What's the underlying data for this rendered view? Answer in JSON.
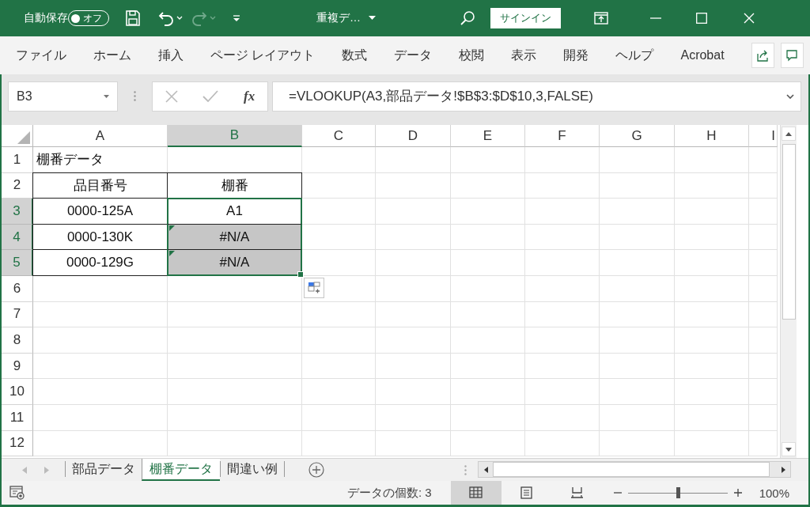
{
  "title_bar": {
    "autosave_label": "自動保存",
    "autosave": {
      "on": false,
      "label": "オフ"
    },
    "document_title": "重複デ…",
    "signin_button": "サインイン"
  },
  "ribbon_tabs": [
    {
      "label": "ファイル"
    },
    {
      "label": "ホーム"
    },
    {
      "label": "挿入"
    },
    {
      "label": "ページ レイアウト"
    },
    {
      "label": "数式"
    },
    {
      "label": "データ"
    },
    {
      "label": "校閲"
    },
    {
      "label": "表示"
    },
    {
      "label": "開発"
    },
    {
      "label": "ヘルプ"
    },
    {
      "label": "Acrobat"
    }
  ],
  "formula_bar": {
    "name_box": "B3",
    "fx_label": "fx",
    "formula": "=VLOOKUP(A3,部品データ!$B$3:$D$10,3,FALSE)"
  },
  "columns": [
    {
      "label": "A",
      "selected": false
    },
    {
      "label": "B",
      "selected": true
    },
    {
      "label": "C",
      "selected": false
    },
    {
      "label": "D",
      "selected": false
    },
    {
      "label": "E",
      "selected": false
    },
    {
      "label": "F",
      "selected": false
    },
    {
      "label": "G",
      "selected": false
    },
    {
      "label": "H",
      "selected": false
    },
    {
      "label": "I",
      "selected": false
    }
  ],
  "rows": [
    {
      "label": "1",
      "selected": false,
      "cells": [
        {
          "kind": "title",
          "text": "棚番データ",
          "bordered": false,
          "selected": false,
          "error_flag": false
        }
      ]
    },
    {
      "label": "2",
      "selected": false,
      "cells": [
        {
          "kind": "value",
          "text": "品目番号",
          "bordered": true,
          "selected": false,
          "error_flag": false
        },
        {
          "kind": "value",
          "text": "棚番",
          "bordered": true,
          "selected": false,
          "error_flag": false
        }
      ]
    },
    {
      "label": "3",
      "selected": true,
      "cells": [
        {
          "kind": "value",
          "text": "0000-125A",
          "bordered": true,
          "selected": false,
          "error_flag": false
        },
        {
          "kind": "value",
          "text": "A1",
          "bordered": true,
          "selected": true,
          "error_flag": false
        }
      ]
    },
    {
      "label": "4",
      "selected": true,
      "cells": [
        {
          "kind": "value",
          "text": "0000-130K",
          "bordered": true,
          "selected": false,
          "error_flag": false
        },
        {
          "kind": "value",
          "text": "#N/A",
          "bordered": true,
          "selected": true,
          "error_flag": true
        }
      ]
    },
    {
      "label": "5",
      "selected": true,
      "cells": [
        {
          "kind": "value",
          "text": "0000-129G",
          "bordered": true,
          "selected": false,
          "error_flag": false
        },
        {
          "kind": "value",
          "text": "#N/A",
          "bordered": true,
          "selected": true,
          "error_flag": true
        }
      ]
    },
    {
      "label": "6",
      "selected": false,
      "cells": []
    },
    {
      "label": "7",
      "selected": false,
      "cells": []
    },
    {
      "label": "8",
      "selected": false,
      "cells": []
    },
    {
      "label": "9",
      "selected": false,
      "cells": []
    },
    {
      "label": "10",
      "selected": false,
      "cells": []
    },
    {
      "label": "11",
      "selected": false,
      "cells": []
    },
    {
      "label": "12",
      "selected": false,
      "cells": []
    }
  ],
  "sheet_tabs": [
    {
      "label": "部品データ",
      "selected": false
    },
    {
      "label": "棚番データ",
      "selected": true
    },
    {
      "label": "間違い例",
      "selected": false
    }
  ],
  "status_bar": {
    "summary": "データの個数: 3",
    "views": [
      {
        "kind": "normal",
        "selected": true
      },
      {
        "kind": "page_layout",
        "selected": false
      },
      {
        "kind": "page_break",
        "selected": false
      }
    ],
    "zoom": {
      "level": 0.5,
      "label": "100%"
    }
  }
}
